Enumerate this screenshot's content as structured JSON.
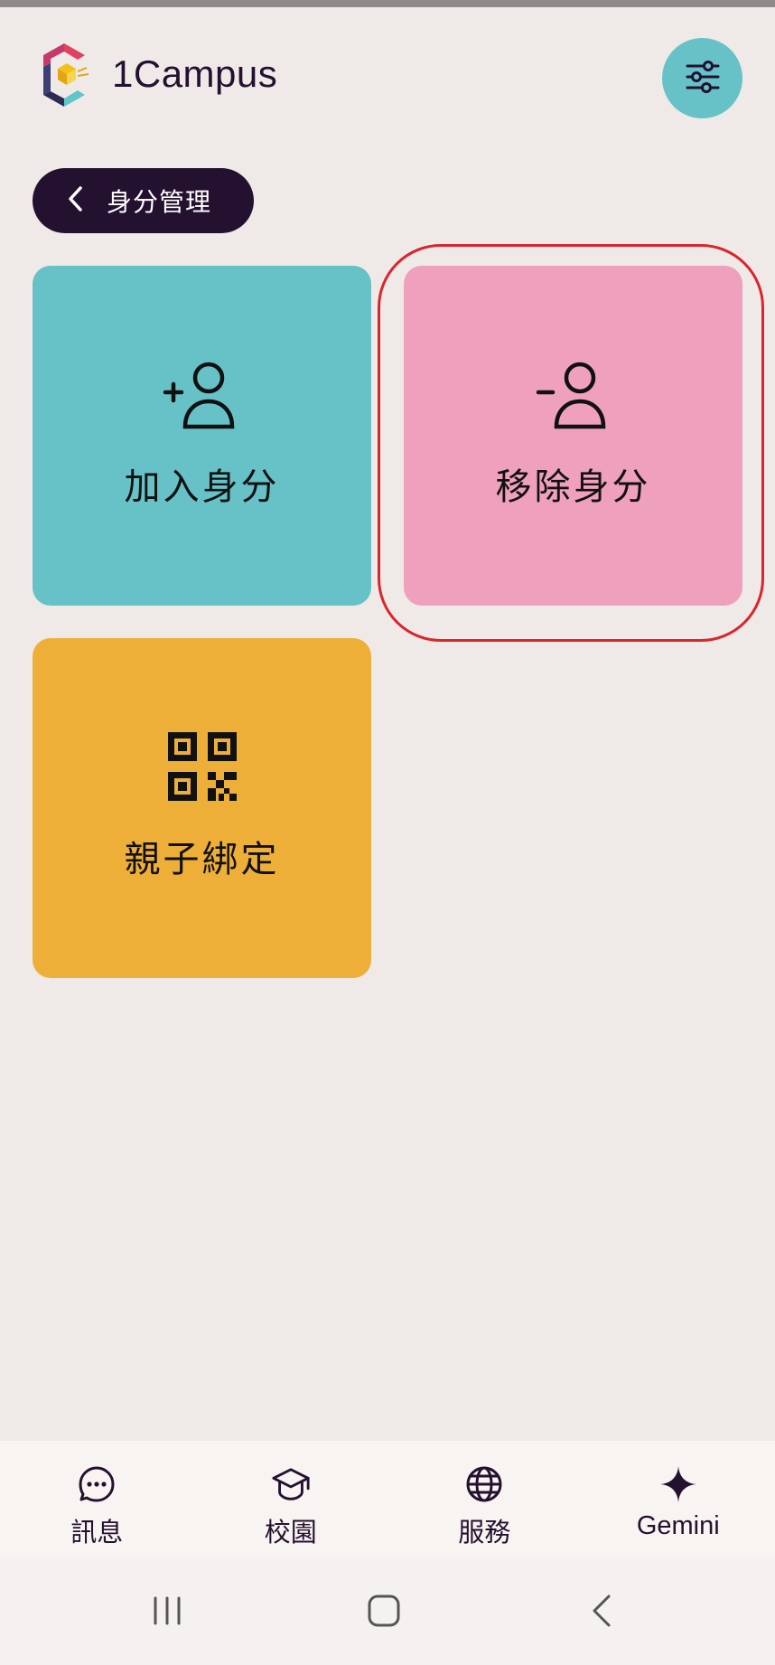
{
  "app": {
    "title": "1Campus"
  },
  "header": {
    "filter_icon": "sliders-icon"
  },
  "breadcrumb": {
    "back_icon": "chevron-left-icon",
    "label": "身分管理"
  },
  "tiles": [
    {
      "label": "加入身分",
      "icon": "person-add-icon",
      "color": "#66c2c7"
    },
    {
      "label": "移除身分",
      "icon": "person-remove-icon",
      "color": "#efa0bd",
      "highlighted": true
    },
    {
      "label": "親子綁定",
      "icon": "qr-code-icon",
      "color": "#eeaf39"
    }
  ],
  "bottom_nav": {
    "items": [
      {
        "label": "訊息",
        "icon": "chat-bubble-icon"
      },
      {
        "label": "校園",
        "icon": "graduation-cap-icon"
      },
      {
        "label": "服務",
        "icon": "globe-icon"
      },
      {
        "label": "Gemini",
        "icon": "sparkle-icon"
      }
    ]
  },
  "system_nav": {
    "items": [
      "recent-apps-icon",
      "home-icon",
      "back-icon"
    ]
  },
  "colors": {
    "background": "#efeae8",
    "primary_dark": "#24112f",
    "teal": "#66c2c7",
    "pink": "#efa0bd",
    "amber": "#eeaf39",
    "highlight_red": "#d9262c"
  }
}
